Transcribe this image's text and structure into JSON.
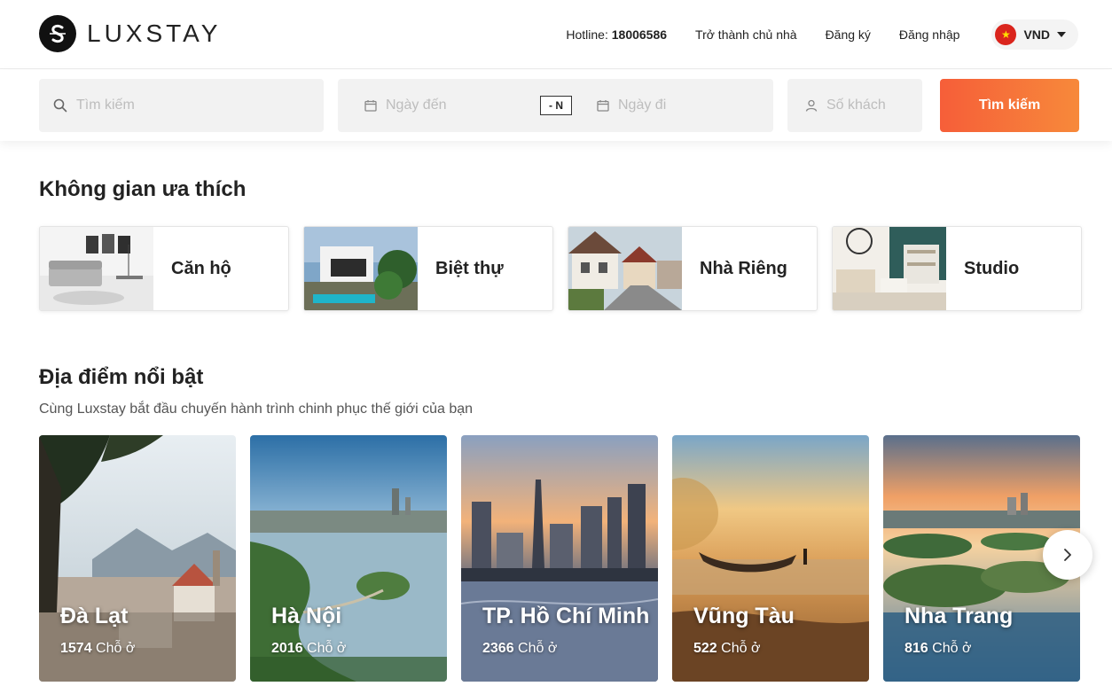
{
  "brand": {
    "name": "LUXSTAY"
  },
  "nav": {
    "hotline_label": "Hotline:",
    "hotline_number": "18006586",
    "become_host": "Trở thành chủ nhà",
    "register": "Đăng ký",
    "login": "Đăng nhập",
    "currency": "VND"
  },
  "search": {
    "keyword_placeholder": "Tìm kiếm",
    "checkin_placeholder": "Ngày đến",
    "nights": "- N",
    "checkout_placeholder": "Ngày đi",
    "guests_placeholder": "Số khách",
    "button_label": "Tìm kiếm"
  },
  "categories": {
    "title": "Không gian ưa thích",
    "items": [
      {
        "label": "Căn hộ"
      },
      {
        "label": "Biệt thự"
      },
      {
        "label": "Nhà Riêng"
      },
      {
        "label": "Studio"
      }
    ]
  },
  "destinations": {
    "title": "Địa điểm nổi bật",
    "subtitle": "Cùng Luxstay bắt đầu chuyến hành trình chinh phục thế giới của bạn",
    "count_unit": "Chỗ ở",
    "items": [
      {
        "name": "Đà Lạt",
        "count": "1574"
      },
      {
        "name": "Hà Nội",
        "count": "2016"
      },
      {
        "name": "TP. Hồ Chí Minh",
        "count": "2366"
      },
      {
        "name": "Vũng Tàu",
        "count": "522"
      },
      {
        "name": "Nha Trang",
        "count": "816"
      }
    ]
  },
  "colors": {
    "accent_start": "#f65e39",
    "accent_end": "#f7893a",
    "flag_red": "#da251d",
    "flag_star": "#ffde00"
  },
  "icons": {
    "search": "search-icon",
    "calendar": "calendar-icon",
    "guest": "user-icon",
    "next": "chevron-right-icon"
  }
}
